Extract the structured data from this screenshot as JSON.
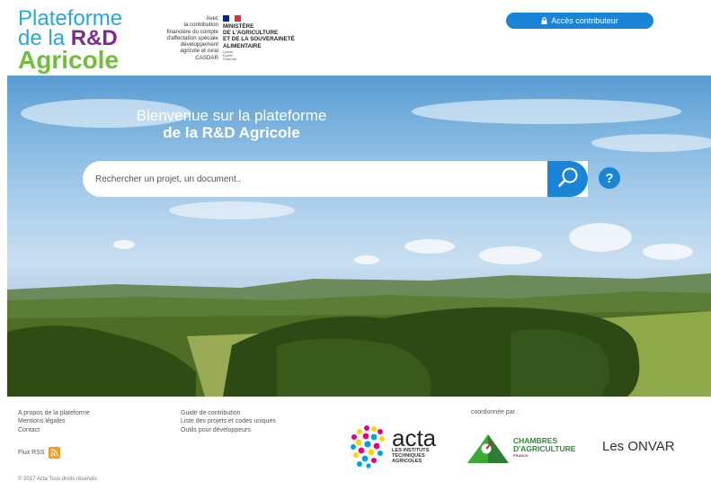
{
  "header": {
    "logo": {
      "line1": "Plateforme",
      "line2_prefix": "de la ",
      "line2_strong": "R&D",
      "line3": "Agricole"
    },
    "casdar_text": [
      "Avec",
      "la contribution",
      "financière du compte",
      "d'affectation spéciale",
      "développement",
      "agricole et rural",
      "CASDAR"
    ],
    "ministry": {
      "lines": [
        "MINISTÈRE",
        "DE L'AGRICULTURE",
        "ET DE LA SOUVERAINETÉ",
        "ALIMENTAIRE"
      ],
      "motto": [
        "Liberté",
        "Égalité",
        "Fraternité"
      ]
    },
    "contributor_button": "Accès contributeur"
  },
  "hero": {
    "title_line1": "Bienvenue sur la plateforme",
    "title_line2": "de la R&D Agricole",
    "search": {
      "placeholder": "Rechercher un projet, un document..",
      "value": ""
    },
    "help_label": "?"
  },
  "footer": {
    "col1": [
      "A propos de la plateforme",
      "Mentions légales",
      "Contact"
    ],
    "col2": [
      "Guide de contribution",
      "Liste des projets et codes uniques",
      "Outils pour développeurs"
    ],
    "rss_label": "Flux RSS",
    "coord_label": "coordonnée par :",
    "acta": {
      "name": "acta",
      "sub": [
        "LES INSTITUTS",
        "TECHNIQUES",
        "AGRICOLES"
      ]
    },
    "chambres": {
      "line1": "CHAMBRES",
      "line2": "D'AGRICULTURE",
      "line3": "FRANCE"
    },
    "onvar": "Les ONVAR",
    "copyright": "© 2017 Acta Tous droits réservés"
  },
  "colors": {
    "primary": "#1a84d6",
    "logo_blue": "#2aa6d9",
    "logo_purple": "#7d2b8e",
    "logo_green": "#6fbf3a",
    "rss": "#f59a23"
  },
  "icons": {
    "lock": "lock-icon",
    "search": "magnifier-icon",
    "rss": "rss-icon",
    "help": "question-icon"
  }
}
